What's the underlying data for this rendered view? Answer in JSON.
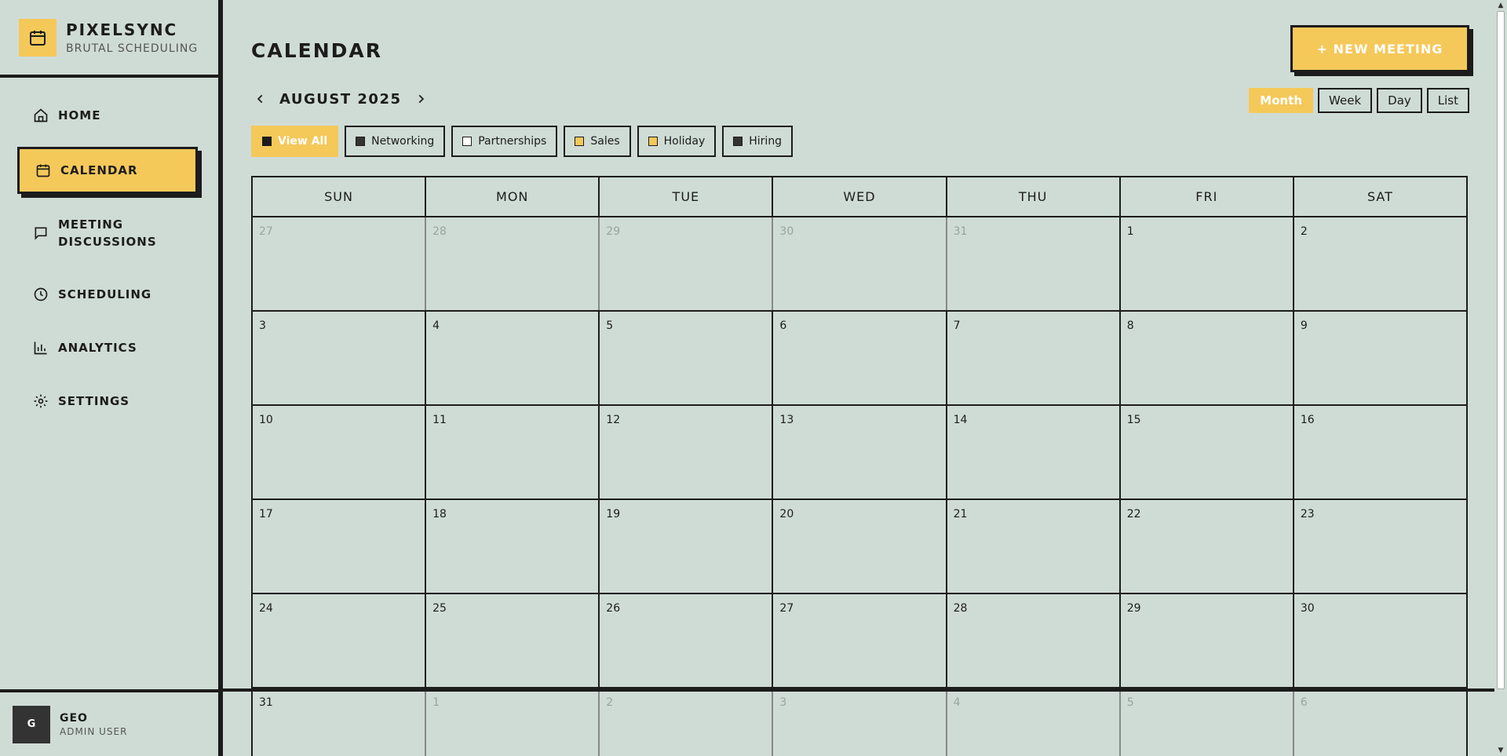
{
  "brand": {
    "name": "PIXELSYNC",
    "subtitle": "BRUTAL SCHEDULING"
  },
  "nav": [
    {
      "label": "HOME",
      "icon": "home-icon"
    },
    {
      "label": "CALENDAR",
      "icon": "calendar-icon",
      "active": true
    },
    {
      "label": "MEETING DISCUSSIONS",
      "icon": "chat-icon"
    },
    {
      "label": "SCHEDULING",
      "icon": "clock-icon"
    },
    {
      "label": "ANALYTICS",
      "icon": "bar-chart-icon"
    },
    {
      "label": "SETTINGS",
      "icon": "gear-icon"
    }
  ],
  "user": {
    "initial": "G",
    "name": "GEO",
    "role": "ADMIN USER"
  },
  "header": {
    "title": "CALENDAR",
    "new_meeting": "+ NEW MEETING"
  },
  "month_label": "AUGUST 2025",
  "views": [
    "Month",
    "Week",
    "Day",
    "List"
  ],
  "active_view": "Month",
  "filters": [
    {
      "label": "View All",
      "active": true
    },
    {
      "label": "Networking"
    },
    {
      "label": "Partnerships"
    },
    {
      "label": "Sales"
    },
    {
      "label": "Holiday"
    },
    {
      "label": "Hiring"
    }
  ],
  "weekdays": [
    "SUN",
    "MON",
    "TUE",
    "WED",
    "THU",
    "FRI",
    "SAT"
  ],
  "weeks": [
    [
      {
        "d": "27",
        "o": true
      },
      {
        "d": "28",
        "o": true
      },
      {
        "d": "29",
        "o": true
      },
      {
        "d": "30",
        "o": true
      },
      {
        "d": "31",
        "o": true
      },
      {
        "d": "1"
      },
      {
        "d": "2"
      }
    ],
    [
      {
        "d": "3"
      },
      {
        "d": "4"
      },
      {
        "d": "5"
      },
      {
        "d": "6"
      },
      {
        "d": "7"
      },
      {
        "d": "8"
      },
      {
        "d": "9"
      }
    ],
    [
      {
        "d": "10"
      },
      {
        "d": "11"
      },
      {
        "d": "12"
      },
      {
        "d": "13"
      },
      {
        "d": "14"
      },
      {
        "d": "15"
      },
      {
        "d": "16"
      }
    ],
    [
      {
        "d": "17"
      },
      {
        "d": "18"
      },
      {
        "d": "19"
      },
      {
        "d": "20"
      },
      {
        "d": "21"
      },
      {
        "d": "22"
      },
      {
        "d": "23"
      }
    ],
    [
      {
        "d": "24"
      },
      {
        "d": "25"
      },
      {
        "d": "26"
      },
      {
        "d": "27"
      },
      {
        "d": "28"
      },
      {
        "d": "29"
      },
      {
        "d": "30"
      }
    ],
    [
      {
        "d": "31"
      },
      {
        "d": "1",
        "o": true
      },
      {
        "d": "2",
        "o": true
      },
      {
        "d": "3",
        "o": true
      },
      {
        "d": "4",
        "o": true
      },
      {
        "d": "5",
        "o": true
      },
      {
        "d": "6",
        "o": true
      }
    ]
  ],
  "colors": {
    "accent": "#f5c85a",
    "ink": "#1c1c1c",
    "background": "#cfdcd6"
  }
}
